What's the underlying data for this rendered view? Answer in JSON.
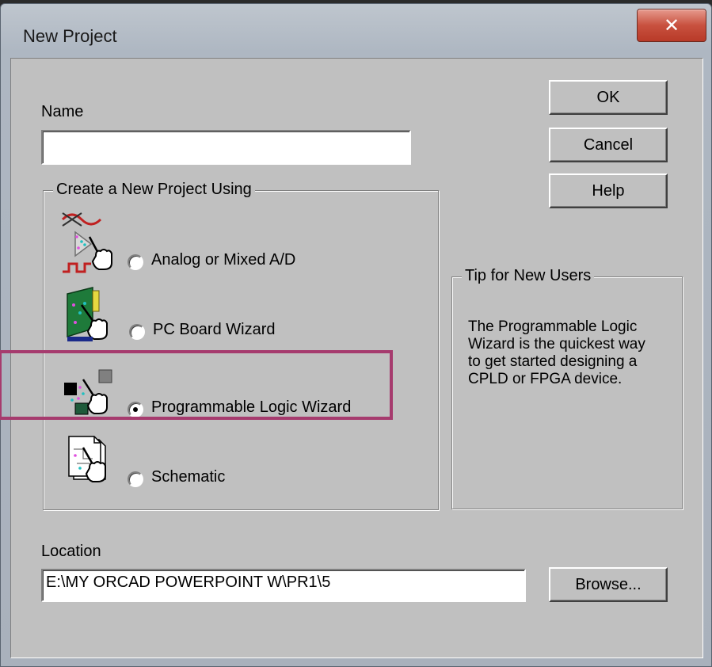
{
  "window": {
    "title": "New Project",
    "close_symbol": "✕"
  },
  "name_field": {
    "label": "Name",
    "value": ""
  },
  "buttons": {
    "ok": "OK",
    "cancel": "Cancel",
    "help": "Help",
    "browse": "Browse..."
  },
  "project_type": {
    "group_title": "Create a New Project Using",
    "options": [
      {
        "label": "Analog or Mixed A/D",
        "icon": "analog-mixed-icon",
        "selected": false
      },
      {
        "label": "PC Board Wizard",
        "icon": "pc-board-icon",
        "selected": false
      },
      {
        "label": "Programmable Logic Wizard",
        "icon": "programmable-logic-icon",
        "selected": true
      },
      {
        "label": "Schematic",
        "icon": "schematic-icon",
        "selected": false
      }
    ]
  },
  "tip": {
    "title": "Tip for New Users",
    "lines": [
      "The Programmable Logic",
      "Wizard is the quickest way",
      "to get started designing a",
      "CPLD or FPGA device."
    ]
  },
  "location": {
    "label": "Location",
    "value": "E:\\MY ORCAD POWERPOINT W\\PR1\\5"
  },
  "colors": {
    "highlight": "#a63b6e",
    "close_button": "#c8513f",
    "dialog_face": "#c0c0c0"
  }
}
